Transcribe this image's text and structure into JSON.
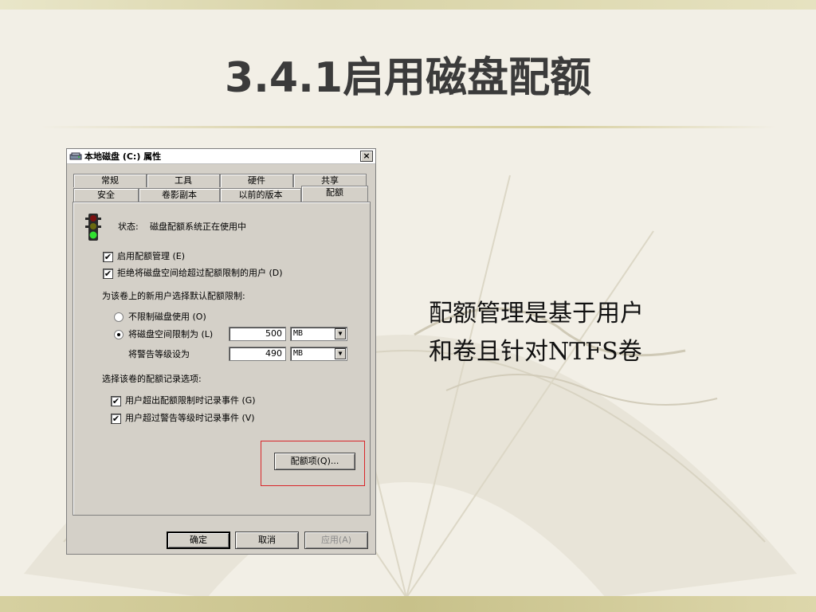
{
  "slide": {
    "title": "3.4.1启用磁盘配额",
    "side_text": {
      "line1": "配额管理是基于用户",
      "line2": "和卷且针对NTFS卷"
    }
  },
  "dialog": {
    "title": "本地磁盘 (C:) 属性",
    "close_label": "×",
    "tabs_row1": [
      "常规",
      "工具",
      "硬件",
      "共享"
    ],
    "tabs_row2": [
      "安全",
      "卷影副本",
      "以前的版本",
      "配额"
    ],
    "active_tab": "配额",
    "status_label": "状态:",
    "status_value": "磁盘配额系统正在使用中",
    "enable_quota": {
      "label": "启用配额管理 (E)",
      "checked": true
    },
    "deny_space": {
      "label": "拒绝将磁盘空间给超过配额限制的用户 (D)",
      "checked": true
    },
    "default_limit_heading": "为该卷上的新用户选择默认配额限制:",
    "no_limit": {
      "label": "不限制磁盘使用 (O)",
      "selected": false
    },
    "limit_space": {
      "label": "将磁盘空间限制为 (L)",
      "selected": true,
      "value": "500",
      "unit": "MB"
    },
    "warning_level": {
      "label": "将警告等级设为",
      "value": "490",
      "unit": "MB"
    },
    "log_heading": "选择该卷的配额记录选项:",
    "log_limit": {
      "label": "用户超出配额限制时记录事件 (G)",
      "checked": true
    },
    "log_warning": {
      "label": "用户超过警告等级时记录事件 (V)",
      "checked": true
    },
    "quota_entries_button": "配额项(Q)...",
    "ok_button": "确定",
    "cancel_button": "取消",
    "apply_button": "应用(A)",
    "check_mark": "✔"
  },
  "colors": {
    "highlight": "#d8262a",
    "title_text": "#3b3b3b"
  }
}
